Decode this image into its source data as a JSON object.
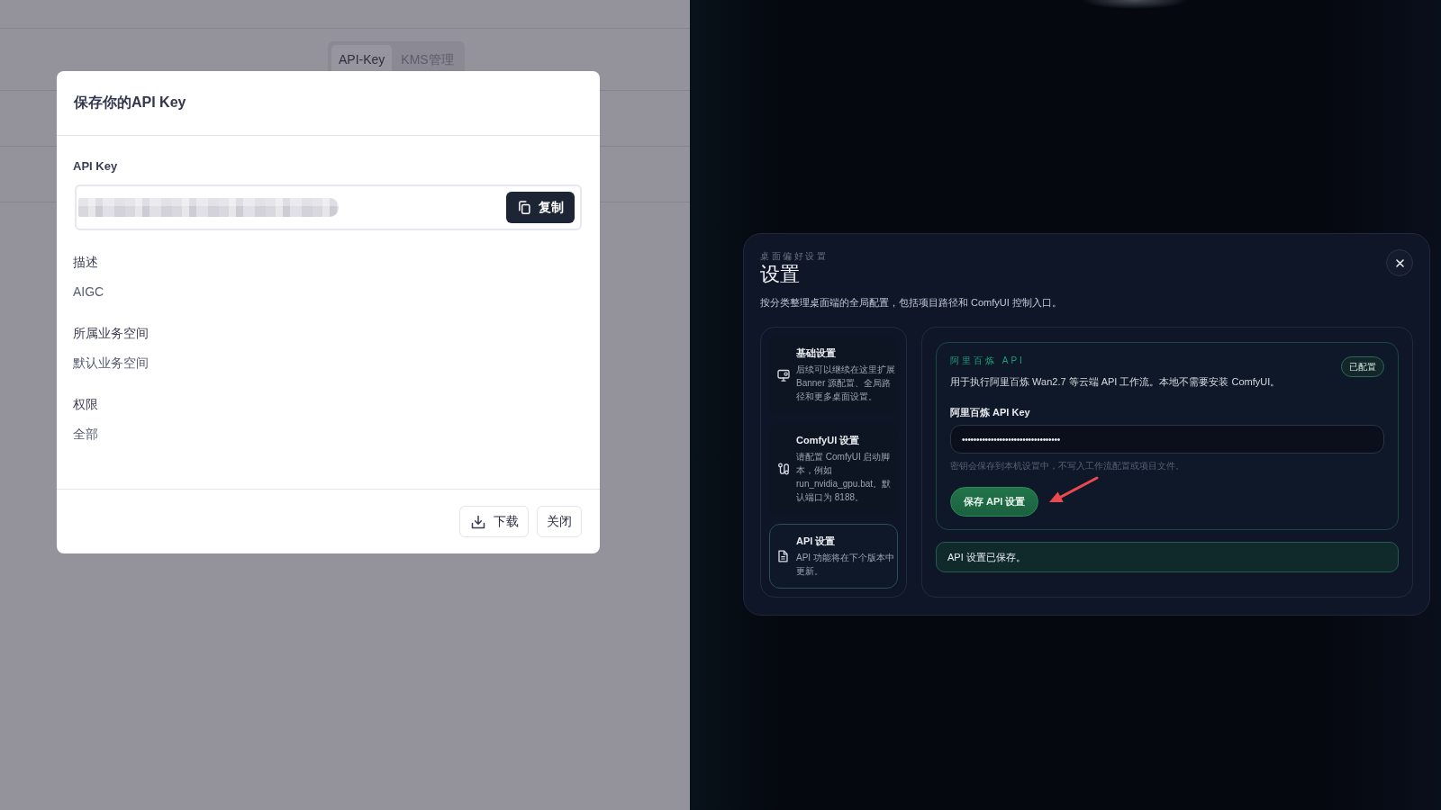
{
  "background_page": {
    "tabs": [
      {
        "label": "API-Key",
        "selected": true
      },
      {
        "label": "KMS管理",
        "selected": false
      }
    ]
  },
  "api_key_dialog": {
    "title": "保存你的API Key",
    "key_label": "API Key",
    "copy_button": "复制",
    "fields": [
      {
        "label": "描述",
        "value": "AIGC"
      },
      {
        "label": "所属业务空间",
        "value": "默认业务空间"
      },
      {
        "label": "权限",
        "value": "全部"
      }
    ],
    "buttons": [
      {
        "kind": "download",
        "label": "下载"
      },
      {
        "kind": "close",
        "label": "关闭"
      }
    ]
  },
  "settings_dialog": {
    "eyebrow": "桌面偏好设置",
    "title": "设置",
    "subtitle": "按分类整理桌面端的全局配置，包括项目路径和 ComfyUI 控制入口。",
    "nav": [
      {
        "kind": "general",
        "title": "基础设置",
        "description": "后续可以继续在这里扩展 Banner 源配置、全局路径和更多桌面设置。",
        "selected": false
      },
      {
        "kind": "comfyui",
        "title": "ComfyUI 设置",
        "description": "请配置 ComfyUI 启动脚本，例如 run_nvidia_gpu.bat。默认端口为 8188。",
        "selected": false
      },
      {
        "kind": "api",
        "title": "API 设置",
        "description": "API 功能将在下个版本中更新。",
        "selected": true
      }
    ],
    "section": {
      "eyebrow": "阿里百炼 API",
      "badge": "已配置",
      "description": "用于执行阿里百炼 Wan2.7 等云端 API 工作流。本地不需要安装 ComfyUI。",
      "key_label": "阿里百炼 API Key",
      "key_value": "••••••••••••••••••••••••••••••••••",
      "hint": "密钥会保存到本机设置中，不写入工作流配置或项目文件。",
      "save_button": "保存 API 设置"
    },
    "status_message": "API 设置已保存。"
  }
}
